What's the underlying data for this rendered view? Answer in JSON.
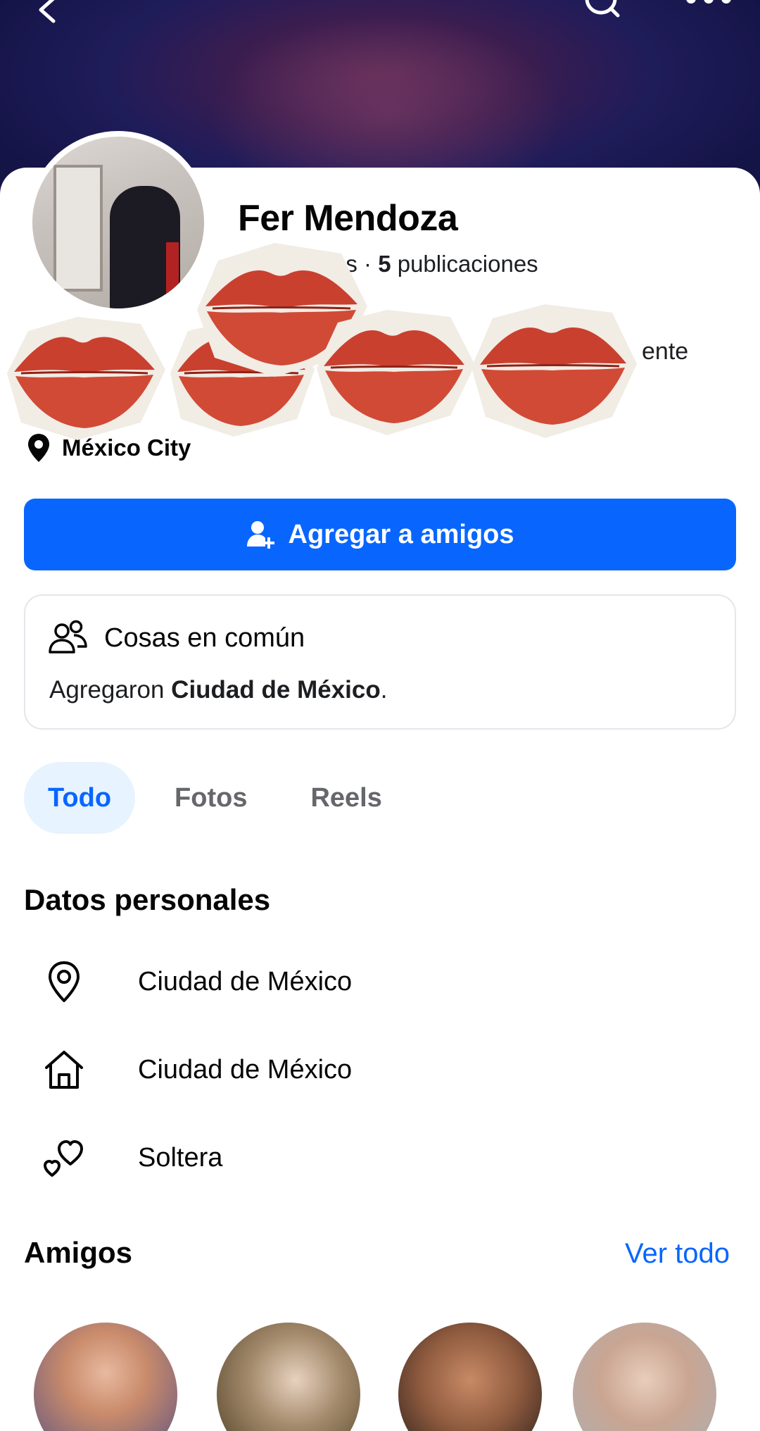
{
  "profile": {
    "name": "Fer Mendoza",
    "stats_prefix_visible": "os",
    "stats_separator": " · ",
    "posts_count": "5",
    "posts_label": " publicaciones",
    "bio_fragment": "ente",
    "city_short": "México City"
  },
  "actions": {
    "add_friend_label": "Agregar a amigos"
  },
  "common": {
    "title": "Cosas en común",
    "detail_prefix": "Agregaron ",
    "detail_bold": "Ciudad de México",
    "detail_suffix": "."
  },
  "tabs": [
    {
      "label": "Todo",
      "active": true
    },
    {
      "label": "Fotos",
      "active": false
    },
    {
      "label": "Reels",
      "active": false
    }
  ],
  "personal": {
    "title": "Datos personales",
    "items": [
      {
        "icon": "location-pin-icon",
        "text": "Ciudad de México"
      },
      {
        "icon": "home-icon",
        "text": "Ciudad de México"
      },
      {
        "icon": "hearts-icon",
        "text": "Soltera"
      }
    ]
  },
  "friends": {
    "title": "Amigos",
    "see_all": "Ver todo"
  },
  "colors": {
    "accent": "#0866ff",
    "tab_active_bg": "#e7f3ff",
    "sticker_red": "#c9402f"
  }
}
